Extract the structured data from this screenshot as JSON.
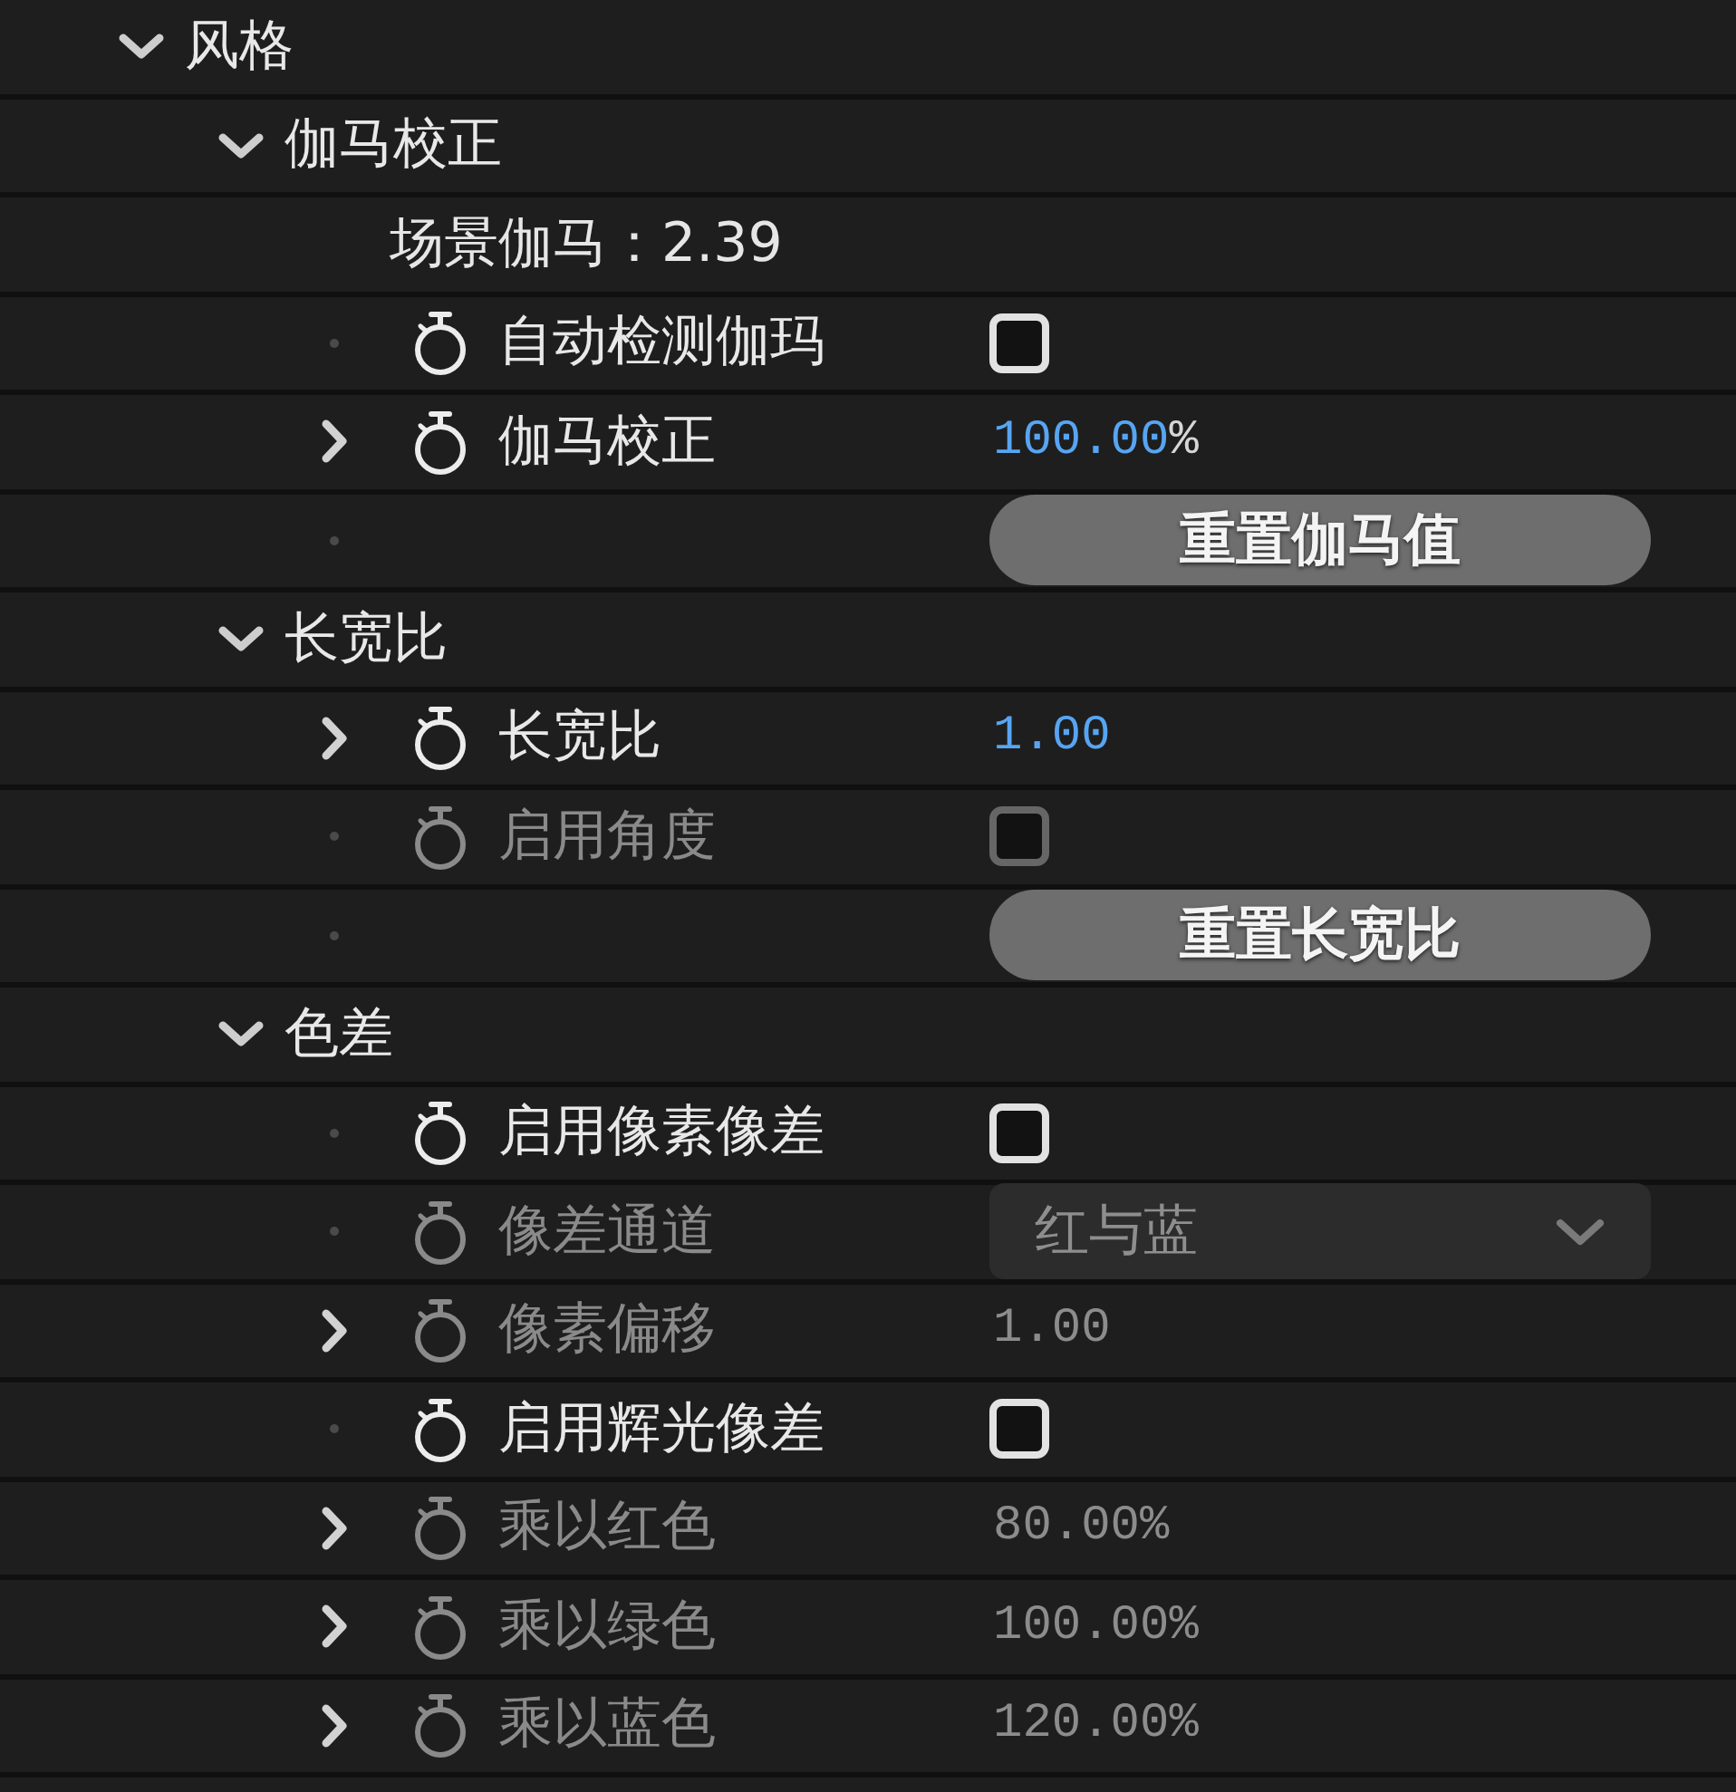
{
  "properties": [
    {
      "kind": "group",
      "label": "风格",
      "expanded": true,
      "children": [
        {
          "kind": "group",
          "label": "伽马校正",
          "expanded": true,
          "children": [
            {
              "kind": "info",
              "text": "场景伽马：2.39"
            },
            {
              "kind": "checkbox",
              "label": "自动检测伽玛",
              "disabled": false,
              "checked": false
            },
            {
              "kind": "number",
              "label": "伽马校正",
              "disabled": false,
              "expanded": false,
              "value": "100.00",
              "unit": "%"
            },
            {
              "kind": "button",
              "label": "重置伽马值"
            }
          ]
        },
        {
          "kind": "group",
          "label": "长宽比",
          "expanded": true,
          "children": [
            {
              "kind": "number",
              "label": "长宽比",
              "disabled": false,
              "expanded": false,
              "value": "1.00"
            },
            {
              "kind": "checkbox",
              "label": "启用角度",
              "disabled": true,
              "checked": false
            },
            {
              "kind": "button",
              "label": "重置长宽比"
            }
          ]
        },
        {
          "kind": "group",
          "label": "色差",
          "expanded": true,
          "children": [
            {
              "kind": "checkbox",
              "label": "启用像素像差",
              "disabled": false,
              "checked": false
            },
            {
              "kind": "dropdown",
              "label": "像差通道",
              "disabled": true,
              "value": "红与蓝"
            },
            {
              "kind": "number",
              "label": "像素偏移",
              "disabled": true,
              "expanded": false,
              "value": "1.00"
            },
            {
              "kind": "checkbox",
              "label": "启用辉光像差",
              "disabled": false,
              "checked": false
            },
            {
              "kind": "number",
              "label": "乘以红色",
              "disabled": true,
              "expanded": false,
              "value": "80.00",
              "unit": "%"
            },
            {
              "kind": "number",
              "label": "乘以绿色",
              "disabled": true,
              "expanded": false,
              "value": "100.00",
              "unit": "%"
            },
            {
              "kind": "number",
              "label": "乘以蓝色",
              "disabled": true,
              "expanded": false,
              "value": "120.00",
              "unit": "%"
            }
          ]
        }
      ]
    }
  ]
}
